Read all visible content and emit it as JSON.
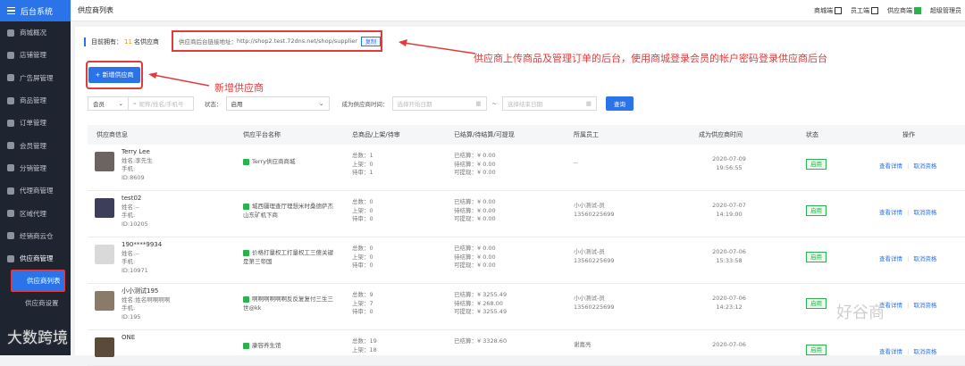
{
  "sidebar": {
    "app_title": "后台系统",
    "items": [
      {
        "label": "商城概况"
      },
      {
        "label": "店铺管理"
      },
      {
        "label": "广告屏管理"
      },
      {
        "label": "商品管理"
      },
      {
        "label": "订单管理"
      },
      {
        "label": "会员管理"
      },
      {
        "label": "分销管理"
      },
      {
        "label": "代理商管理"
      },
      {
        "label": "区域代理"
      },
      {
        "label": "经销商云仓"
      },
      {
        "label": "供应商管理"
      }
    ],
    "sub_items": [
      {
        "label": "供应商列表"
      },
      {
        "label": "供应商设置"
      }
    ]
  },
  "topbar": {
    "title": "供应商列表",
    "links": [
      "商城端",
      "员工端",
      "供应商端"
    ],
    "user": "超级管理员"
  },
  "info": {
    "prefix": "目前拥有：",
    "count": "11",
    "suffix": "名供应商",
    "link_label": "供应商后台链接地址：",
    "link_url": "http://shop2.test.72dns.net/shop/supplier",
    "copy": "复制"
  },
  "annotations": {
    "top": "供应商上传商品及管理订单的后台，使用商城登录会员的帐户密码登录供应商后台",
    "add": "新增供应商"
  },
  "add_button": "+ 新增供应商",
  "filters": {
    "member_select": "会员",
    "search_placeholder": "昵称/姓名/手机号",
    "status_label": "状态：",
    "status_value": "启用",
    "time_label": "成为供应商时间：",
    "start_placeholder": "选择开始日期",
    "range_sep": "~",
    "end_placeholder": "选择结束日期",
    "query": "查询"
  },
  "table": {
    "headers": [
      "供应商信息",
      "供应平台名称",
      "总商品/上架/待审",
      "已结算/待结算/可提现",
      "所属员工",
      "成为供应商时间",
      "状态",
      "操作"
    ],
    "rows": [
      {
        "name": "Terry Lee",
        "real": "姓名:李先生",
        "phone": "手机:",
        "id": "ID:8609",
        "platform": "Terry供应商商城",
        "total": "总数：1",
        "up": "上架：0",
        "pending": "待审：1",
        "settled": "已结算：¥ 0.00",
        "unsettled": "待结算：¥ 0.00",
        "withdraw": "可提现：¥ 0.00",
        "staff": "--",
        "staff_phone": "",
        "date": "2020-07-09",
        "time": "19:56:55",
        "status": "启用",
        "view": "查看详情",
        "cancel": "取消资格"
      },
      {
        "name": "test02",
        "real": "姓名:--",
        "phone": "手机:",
        "id": "ID:10205",
        "platform": "城西疆理查厅理想米时桑德萨杰山东矿机下商",
        "total": "总数：0",
        "up": "上架：0",
        "pending": "待审：0",
        "settled": "已结算：¥ 0.00",
        "unsettled": "待结算：¥ 0.00",
        "withdraw": "可提现：¥ 0.00",
        "staff": "小小测试-员",
        "staff_phone": "13560225699",
        "date": "2020-07-07",
        "time": "14:19:00",
        "status": "启用",
        "view": "查看详情",
        "cancel": "取消资格"
      },
      {
        "name": "190****9934",
        "real": "姓名:--",
        "phone": "手机:",
        "id": "ID:10971",
        "platform": "价格打量权工打量权工三傻关键是第三帝国",
        "total": "总数：0",
        "up": "上架：0",
        "pending": "待审：0",
        "settled": "已结算：¥ 0.00",
        "unsettled": "待结算：¥ 0.00",
        "withdraw": "可提现：¥ 0.00",
        "staff": "小小测试-员",
        "staff_phone": "13560225699",
        "date": "2020-07-06",
        "time": "15:33:58",
        "status": "启用",
        "view": "查看详情",
        "cancel": "取消资格"
      },
      {
        "name": "小小测试195",
        "real": "姓名:姓名啊啊啊啊",
        "phone": "手机:",
        "id": "ID:195",
        "platform": "啊啊啊啊啊啊反反复复付三生三世@kk",
        "total": "总数：9",
        "up": "上架：7",
        "pending": "待审：0",
        "settled": "已结算：¥ 3255.49",
        "unsettled": "待结算：¥ 268.00",
        "withdraw": "可提现：¥ 3255.49",
        "staff": "小小测试-员",
        "staff_phone": "13560225699",
        "date": "2020-07-06",
        "time": "14:23:12",
        "status": "启用",
        "view": "查看详情",
        "cancel": "取消资格"
      },
      {
        "name": "ONE",
        "real": "",
        "phone": "",
        "id": "",
        "platform": "康容养生馆",
        "total": "总数：19",
        "up": "上架：18",
        "pending": "",
        "settled": "已结算：¥ 3328.60",
        "unsettled": "",
        "withdraw": "",
        "staff": "谢嘉亮",
        "staff_phone": "",
        "date": "2020-07-06",
        "time": "",
        "status": "启用",
        "view": "查看详情",
        "cancel": "取消资格"
      }
    ]
  },
  "watermarks": {
    "left": "大数跨境",
    "right": "好谷商"
  }
}
